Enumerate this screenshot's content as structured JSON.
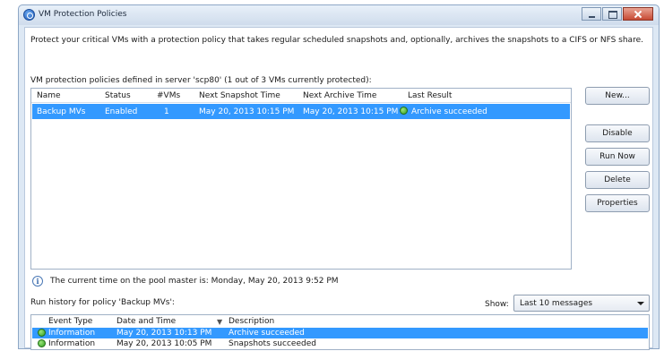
{
  "window": {
    "title": "VM Protection Policies"
  },
  "intro_text": "Protect your critical VMs with a protection policy that takes regular scheduled snapshots and, optionally, archives the snapshots to a CIFS or NFS share.",
  "server_label": "VM protection policies defined in server 'scp80' (1 out of 3 VMs currently protected):",
  "policy_table": {
    "columns": [
      "Name",
      "Status",
      "#VMs",
      "Next Snapshot Time",
      "Next Archive Time",
      "Last Result"
    ],
    "rows": [
      {
        "name": "Backup MVs",
        "status": "Enabled",
        "vms": "1",
        "next_snapshot": "May 20, 2013 10:15 PM",
        "next_archive": "May 20, 2013 10:15 PM",
        "last_result": "Archive succeeded",
        "result_icon": "success-icon"
      }
    ]
  },
  "buttons": {
    "new": "New...",
    "disable": "Disable",
    "run_now": "Run Now",
    "delete": "Delete",
    "properties": "Properties"
  },
  "info_text": "The current time on the pool master is: Monday, May 20, 2013 9:52 PM",
  "history": {
    "label": "Run history for policy 'Backup MVs':",
    "show_label": "Show:",
    "show_value": "Last 10 messages",
    "columns": [
      "Event Type",
      "Date and Time",
      "Description"
    ],
    "rows": [
      {
        "type": "Information",
        "datetime": "May 20, 2013 10:13 PM",
        "description": "Archive succeeded"
      },
      {
        "type": "Information",
        "datetime": "May 20, 2013 10:05 PM",
        "description": "Snapshots succeeded"
      }
    ]
  },
  "colors": {
    "selection": "#3399ff",
    "frame": "#dde8f4",
    "success": "#2f9d1f"
  }
}
